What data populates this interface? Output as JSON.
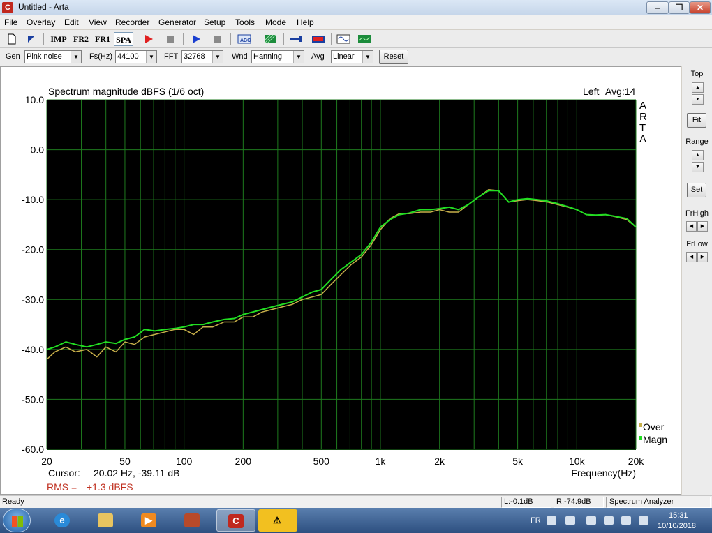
{
  "window": {
    "title": "Untitled - Arta",
    "minimize": "–",
    "maximize": "❐",
    "close": "✕"
  },
  "menu": [
    "File",
    "Overlay",
    "Edit",
    "View",
    "Recorder",
    "Generator",
    "Setup",
    "Tools",
    "Mode",
    "Help"
  ],
  "toolbar": {
    "imp": "IMP",
    "fr2": "FR2",
    "fr1": "FR1",
    "spa": "SPA"
  },
  "controls": {
    "gen_label": "Gen",
    "gen_value": "Pink noise",
    "fs_label": "Fs(Hz)",
    "fs_value": "44100",
    "fft_label": "FFT",
    "fft_value": "32768",
    "wnd_label": "Wnd",
    "wnd_value": "Hanning",
    "avg_label": "Avg",
    "avg_value": "Linear",
    "reset_label": "Reset"
  },
  "side_panel": {
    "top_label": "Top",
    "fit_label": "Fit",
    "range_label": "Range",
    "set_label": "Set",
    "frhigh_label": "FrHigh",
    "frlow_label": "FrLow"
  },
  "chart_data": {
    "type": "line",
    "title": "Spectrum magnitude dBFS (1/6 oct)",
    "channel": "Left",
    "avg": "Avg:14",
    "watermark": [
      "A",
      "R",
      "T",
      "A"
    ],
    "xlabel": "Frequency(Hz)",
    "x_scale": "log",
    "xlim": [
      20,
      20000
    ],
    "ylim": [
      -60,
      10
    ],
    "x_ticks": [
      20,
      50,
      100,
      200,
      500,
      1000,
      2000,
      5000,
      10000,
      20000
    ],
    "x_tick_labels": [
      "20",
      "50",
      "100",
      "200",
      "500",
      "1k",
      "2k",
      "5k",
      "10k",
      "20k"
    ],
    "y_ticks": [
      10,
      0,
      -10,
      -20,
      -30,
      -40,
      -50,
      -60
    ],
    "y_tick_labels": [
      "10.0",
      "0.0",
      "-10.0",
      "-20.0",
      "-30.0",
      "-40.0",
      "-50.0",
      "-60.0"
    ],
    "grid": true,
    "legend_position": "bottom-right",
    "series": [
      {
        "name": "Over",
        "color": "#c8b04a",
        "x": [
          20,
          22,
          25,
          28,
          32,
          36,
          40,
          45,
          50,
          56,
          63,
          71,
          80,
          90,
          100,
          112,
          125,
          140,
          160,
          180,
          200,
          224,
          250,
          280,
          315,
          355,
          400,
          450,
          500,
          560,
          630,
          710,
          800,
          900,
          1000,
          1120,
          1250,
          1400,
          1600,
          1800,
          2000,
          2240,
          2500,
          2800,
          3150,
          3550,
          4000,
          4500,
          5000,
          5600,
          6300,
          7100,
          8000,
          9000,
          10000,
          11200,
          12500,
          14000,
          16000,
          18000,
          20000
        ],
        "y": [
          -42,
          -40.5,
          -39.5,
          -40.5,
          -40,
          -41.5,
          -39.5,
          -40.5,
          -38.5,
          -39,
          -37.5,
          -37,
          -36.5,
          -36,
          -36,
          -37,
          -35.5,
          -35.5,
          -34.5,
          -34.5,
          -33.5,
          -33.5,
          -32.5,
          -32,
          -31.5,
          -31,
          -30,
          -29.5,
          -29,
          -27,
          -25,
          -23,
          -21.5,
          -19,
          -16,
          -13.8,
          -12.8,
          -12.8,
          -12.5,
          -12.5,
          -12,
          -12.5,
          -12.5,
          -11,
          -9.5,
          -8,
          -8.2,
          -10.5,
          -10.2,
          -10,
          -10.2,
          -10.5,
          -11,
          -11.5,
          -12,
          -13,
          -13.2,
          -13,
          -13.5,
          -14,
          -15.5
        ]
      },
      {
        "name": "Magn",
        "color": "#22dd22",
        "x": [
          20,
          22,
          25,
          28,
          32,
          36,
          40,
          45,
          50,
          56,
          63,
          71,
          80,
          90,
          100,
          112,
          125,
          140,
          160,
          180,
          200,
          224,
          250,
          280,
          315,
          355,
          400,
          450,
          500,
          560,
          630,
          710,
          800,
          900,
          1000,
          1120,
          1250,
          1400,
          1600,
          1800,
          2000,
          2240,
          2500,
          2800,
          3150,
          3550,
          4000,
          4500,
          5000,
          5600,
          6300,
          7100,
          8000,
          9000,
          10000,
          11200,
          12500,
          14000,
          16000,
          18000,
          20000
        ],
        "y": [
          -40,
          -39.5,
          -38.5,
          -39,
          -39.5,
          -39,
          -38.5,
          -38.8,
          -38,
          -37.5,
          -36,
          -36.3,
          -36,
          -35.8,
          -35.5,
          -35,
          -35,
          -34.5,
          -34,
          -33.8,
          -33,
          -32.5,
          -32,
          -31.5,
          -31,
          -30.5,
          -29.5,
          -28.5,
          -28,
          -26,
          -24,
          -22.5,
          -21,
          -18.5,
          -15.5,
          -14,
          -13,
          -12.7,
          -12,
          -12,
          -11.8,
          -11.5,
          -12,
          -11,
          -9.5,
          -8.2,
          -8.2,
          -10.5,
          -10,
          -9.8,
          -10,
          -10.3,
          -10.8,
          -11.4,
          -12,
          -13,
          -13.1,
          -13,
          -13.4,
          -13.8,
          -15.5
        ]
      }
    ]
  },
  "cursor": {
    "label": "Cursor:",
    "value": "20.02 Hz, -39.11 dB"
  },
  "rms": {
    "label": "RMS =",
    "value": "+1.3 dBFS",
    "color": "#c03020"
  },
  "statusbar": {
    "ready": "Ready",
    "left_level": "L:-0.1dB",
    "right_level": "R:-74.9dB",
    "mode": "Spectrum Analyzer"
  },
  "taskbar": {
    "language": "FR",
    "time": "15:31",
    "date": "10/10/2018"
  },
  "icons": [
    "new-file-icon",
    "open-icon",
    "record-icon",
    "stop-icon",
    "play-icon",
    "abc-icon",
    "hatch-icon",
    "generator-icon",
    "sine-icon",
    "meter-icon",
    "start-icon",
    "ie-icon",
    "explorer-icon",
    "media-player-icon",
    "arta-icon",
    "warning-icon"
  ]
}
